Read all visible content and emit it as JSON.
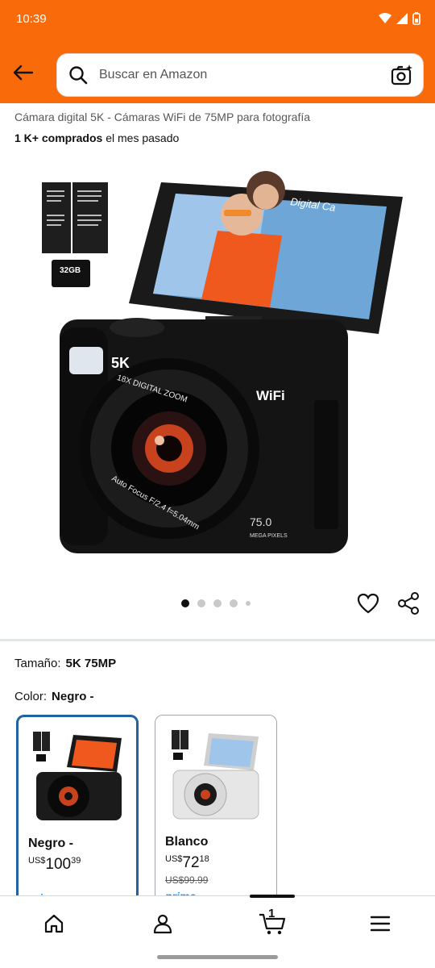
{
  "status_bar": {
    "time": "10:39"
  },
  "search": {
    "placeholder": "Buscar en Amazon"
  },
  "product": {
    "title": "Cámara digital 5K - Cámaras WiFi de 75MP para fotografía",
    "bought_bold": "1 K+ comprados",
    "bought_rest": " el mes pasado",
    "image_labels": {
      "five_k": "5K",
      "wifi": "WiFi",
      "zoom": "18X DIGITAL ZOOM",
      "focus": "Auto Focus F/2.4 f=5.04mm",
      "megapixels": "75.0",
      "megapixels_unit": "MEGA PIXELS",
      "sd_card": "32GB",
      "screen_text": "Digital Ca"
    }
  },
  "gallery": {
    "image_count": 5,
    "active_index": 0
  },
  "size": {
    "label": "Tamaño:",
    "value": "5K 75MP"
  },
  "color": {
    "label": "Color:",
    "value": "Negro -"
  },
  "swatches": [
    {
      "name": "Negro -",
      "currency": "US$",
      "whole": "100",
      "fraction": "39",
      "strike_price": "",
      "prime": "prime",
      "selected": true,
      "color": "#1b1b1b"
    },
    {
      "name": "Blanco",
      "currency": "US$",
      "whole": "72",
      "fraction": "18",
      "strike_price": "US$99.99",
      "prime": "prime",
      "selected": false,
      "color": "#e6e6e6"
    }
  ],
  "nav": {
    "cart_count": "1",
    "items": [
      "home-icon",
      "account-icon",
      "cart-icon",
      "menu-icon"
    ]
  },
  "colors": {
    "header": "#f96a0a",
    "selected_border": "#2162a1",
    "prime_blue": "#1a98ff"
  }
}
